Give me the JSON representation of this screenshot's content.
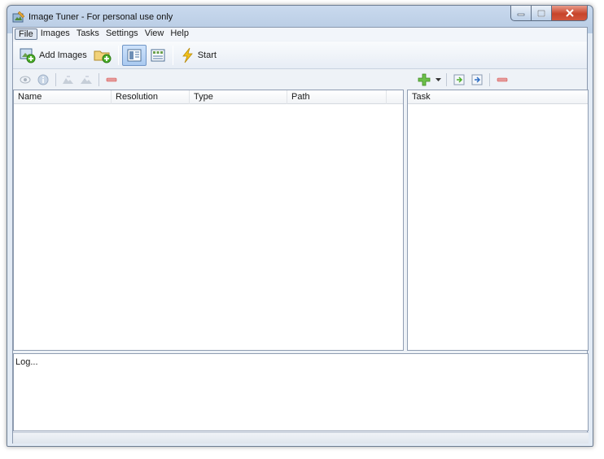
{
  "window": {
    "title": "Image Tuner - For personal use only"
  },
  "menu": {
    "items": [
      "File",
      "Images",
      "Tasks",
      "Settings",
      "View",
      "Help"
    ]
  },
  "toolbar": {
    "add_images_label": "Add Images",
    "start_label": "Start"
  },
  "file_list": {
    "columns": [
      "Name",
      "Resolution",
      "Type",
      "Path"
    ]
  },
  "task_list": {
    "columns": [
      "Task"
    ]
  },
  "log": {
    "text": "Log..."
  },
  "colors": {
    "accent_green": "#4caf2a",
    "remove_red": "#d9534f",
    "start_yellow": "#f2c21a"
  },
  "icons": [
    "app-icon",
    "add-images-icon",
    "add-folder-icon",
    "view-details-icon",
    "view-thumbnails-icon",
    "start-icon",
    "preview-icon",
    "info-icon",
    "rotate-left-icon",
    "rotate-right-icon",
    "remove-icon",
    "add-task-icon",
    "dropdown-icon",
    "import-task-icon",
    "export-task-icon",
    "remove-task-icon"
  ]
}
